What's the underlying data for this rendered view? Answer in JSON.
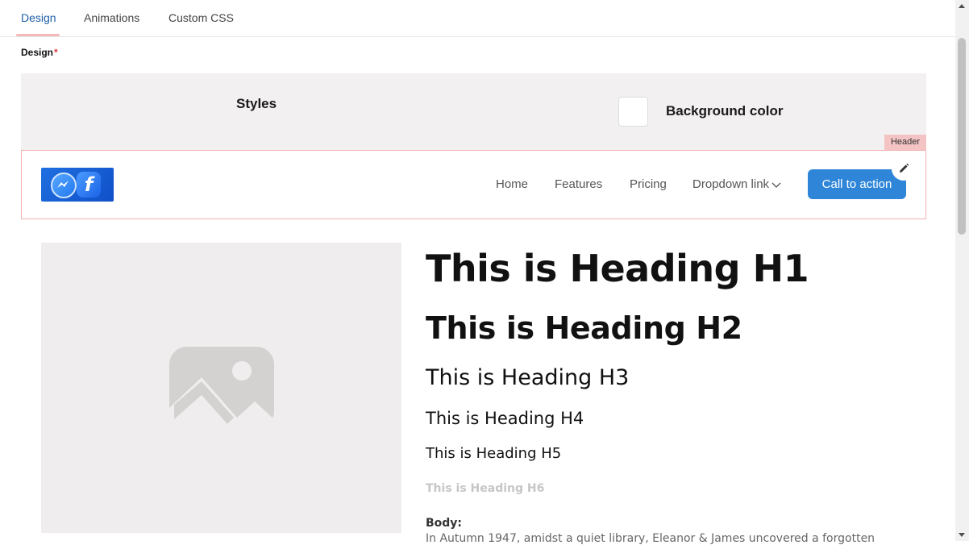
{
  "tabs": [
    {
      "label": "Design",
      "active": true
    },
    {
      "label": "Animations",
      "active": false
    },
    {
      "label": "Custom CSS",
      "active": false
    }
  ],
  "section": {
    "label": "Design",
    "required_mark": "*"
  },
  "styles_bar": {
    "styles_label": "Styles",
    "background_label": "Background color",
    "background_value": "#ffffff"
  },
  "header_preview": {
    "badge": "Header",
    "nav": [
      "Home",
      "Features",
      "Pricing",
      "Dropdown link"
    ],
    "cta": "Call to action"
  },
  "content": {
    "h1": "This is Heading H1",
    "h2": "This is Heading H2",
    "h3": "This is Heading H3",
    "h4": "This is Heading H4",
    "h5": "This is Heading H5",
    "h6": "This is Heading H6",
    "body_label": "Body:",
    "body_text": "In Autumn 1947, amidst a quiet library, Eleanor & James uncovered a forgotten"
  },
  "colors": {
    "accent": "#2f86d8",
    "tab_active": "#1f5fa8",
    "header_border": "#f2b3b3"
  }
}
